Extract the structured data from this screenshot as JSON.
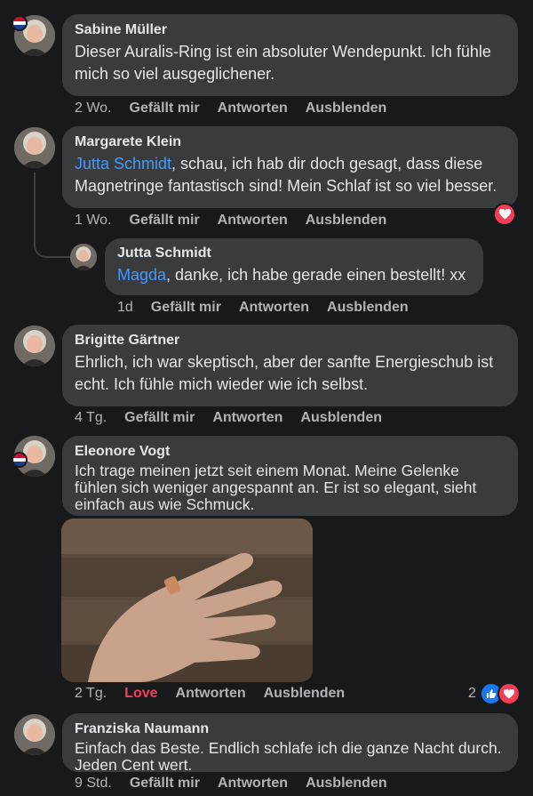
{
  "comments": [
    {
      "author": "Sabine Müller",
      "text": "Dieser Auralis-Ring ist ein absoluter Wendepunkt. Ich fühle mich so viel ausgeglichener.",
      "time": "2 Wo.",
      "like": "Gefällt mir",
      "reply": "Antworten",
      "hide": "Ausblenden"
    },
    {
      "author": "Margarete Klein",
      "mention": "Jutta Schmidt",
      "text": ", schau, ich hab dir doch gesagt, dass diese Magnetringe fantastisch sind! Mein Schlaf ist so viel besser.",
      "time": "1 Wo.",
      "like": "Gefällt mir",
      "reply": "Antworten",
      "hide": "Ausblenden"
    },
    {
      "author": "Jutta Schmidt",
      "mention": "Magda",
      "text": ", danke, ich habe gerade einen bestellt! xx",
      "time": "1d",
      "like": "Gefällt mir",
      "reply": "Antworten",
      "hide": "Ausblenden"
    },
    {
      "author": "Brigitte Gärtner",
      "text": "Ehrlich, ich war skeptisch, aber der sanfte Energieschub ist echt. Ich fühle mich wieder wie ich selbst.",
      "time": "4 Tg.",
      "like": "Gefällt mir",
      "reply": "Antworten",
      "hide": "Ausblenden"
    },
    {
      "author": "Eleonore Vogt",
      "text": "Ich trage meinen jetzt seit einem Monat. Meine Gelenke fühlen sich weniger angespannt an. Er ist so elegant, sieht einfach aus wie Schmuck.",
      "time": "2 Tg.",
      "like": "Love",
      "reply": "Antworten",
      "hide": "Ausblenden",
      "reaction_count": "2"
    },
    {
      "author": "Franziska Naumann",
      "text": "Einfach das Beste. Endlich schlafe ich die ganze Nacht durch. Jeden Cent wert.",
      "time": "9 Std.",
      "like": "Gefällt mir",
      "reply": "Antworten",
      "hide": "Ausblenden"
    }
  ],
  "icons": {
    "heart": "heart-reaction-icon",
    "like": "like-reaction-icon",
    "flag": "flag-badge-icon"
  },
  "colors": {
    "background": "#18191a",
    "bubble": "#3a3b3c",
    "mention": "#4599ff",
    "love": "#f33e58",
    "like": "#1877f2",
    "meta": "#b0b3b8"
  }
}
